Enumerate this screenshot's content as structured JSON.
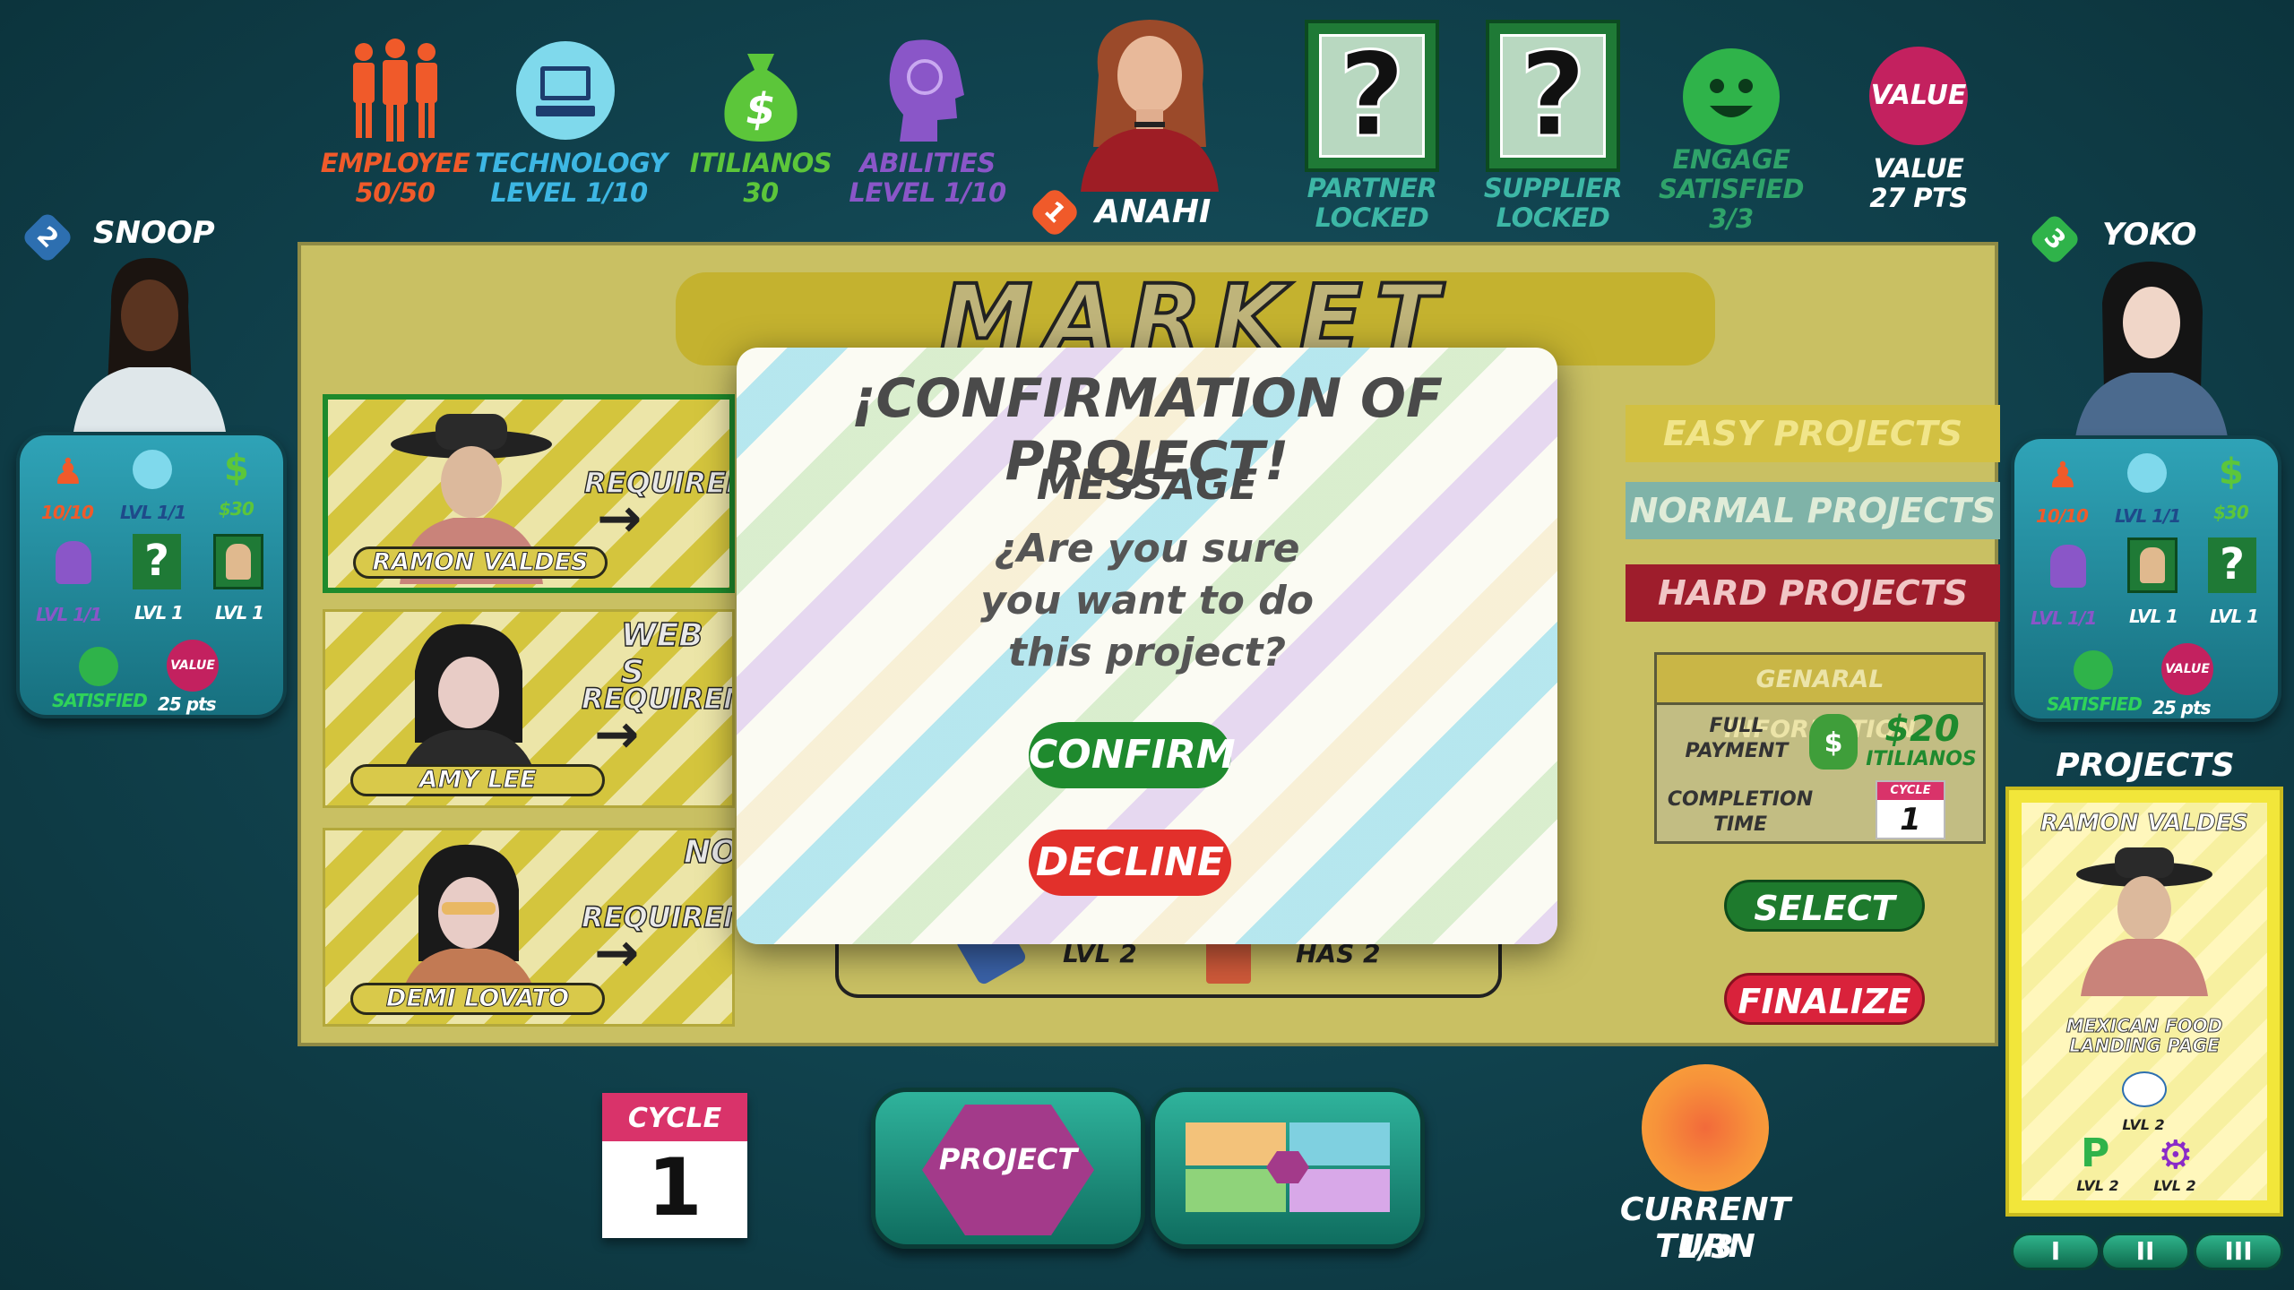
{
  "top_stats": {
    "employee": {
      "label": "EMPLOYEE",
      "value": "50/50"
    },
    "technology": {
      "label": "TECHNOLOGY",
      "value": "LEVEL  1/10"
    },
    "itilianos": {
      "label": "ITILIANOS",
      "value": "30"
    },
    "abilities": {
      "label": "ABILITIES",
      "value": "LEVEL  1/10"
    },
    "partner": {
      "label": "PARTNER",
      "value": "LOCKED"
    },
    "supplier": {
      "label": "SUPPLIER",
      "value": "LOCKED"
    },
    "engage": {
      "label1": "ENGAGE",
      "label2": "SATISFIED",
      "value": "3/3"
    },
    "value": {
      "badge": "VALUE",
      "label": "VALUE",
      "value": "27 PTS"
    }
  },
  "current_player": {
    "number": "1",
    "name": "ANAHI"
  },
  "player_left": {
    "number": "2",
    "name": "SNOOP",
    "stats": {
      "employees": "10/10",
      "tech": "LVL 1/1",
      "money": "$30",
      "abilities": "LVL 1/1",
      "partner": "LVL 1",
      "supplier": "LVL 1",
      "satisfied": "SATISFIED",
      "value_badge": "VALUE",
      "points": "25 pts"
    }
  },
  "player_right": {
    "number": "3",
    "name": "YOKO",
    "stats": {
      "employees": "10/10",
      "tech": "LVL 1/1",
      "money": "$30",
      "abilities": "LVL 1/1",
      "partner": "LVL 1",
      "supplier": "LVL 1",
      "satisfied": "SATISFIED",
      "value_badge": "VALUE",
      "points": "25 pts"
    }
  },
  "board": {
    "title": "MARKET DEMAND",
    "clients": [
      {
        "name": "RAMON VALDES",
        "header": "",
        "req": "REQUIREM"
      },
      {
        "name": "AMY LEE",
        "header": "WEB S",
        "req": "REQUIREM"
      },
      {
        "name": "DEMI LOVATO",
        "header": "NON",
        "req": "REQUIREM"
      }
    ],
    "requirement_row": {
      "level": "LVL 2",
      "has": "HAS 2"
    },
    "tabs": {
      "easy": "EASY PROJECTS",
      "normal": "NORMAL PROJECTS",
      "hard": "HARD PROJECTS"
    },
    "info": {
      "title": "GENARAL INFORMATION",
      "payment_label": "FULL PAYMENT",
      "payment_value": "$20",
      "payment_unit": "ITILIANOS",
      "time_label": "COMPLETION TIME",
      "cycle_badge": "CYCLE",
      "time_value": "1"
    },
    "select_label": "SELECT",
    "finalize_label": "FINALIZE"
  },
  "modal": {
    "title": "¡CONFIRMATION OF PROJECT!",
    "heading": "MESSAGE",
    "line1": "¿Are you sure",
    "line2": "you want to do",
    "line3": "this project?",
    "confirm_label": "CONFIRM",
    "decline_label": "DECLINE"
  },
  "bottom": {
    "cycle_label": "CYCLE",
    "cycle_value": "1",
    "project_button_label": "PROJECT",
    "turn_label": "CURRENT TURN",
    "turn_value": "1/3"
  },
  "projects_panel": {
    "title": "PROJECTS",
    "card": {
      "client": "RAMON VALDES",
      "project_line1": "MEXICAN FOOD",
      "project_line2": "LANDING PAGE",
      "tech_level": "LVL 2",
      "partner_level": "LVL 2",
      "ability_level": "LVL 2"
    },
    "pages": [
      "I",
      "II",
      "III"
    ]
  },
  "colors": {
    "employee": "#f05a2a",
    "technology": "#3db7e4",
    "itilianos": "#5cc63a",
    "abilities": "#8a56c8",
    "partner": "#1f8a3a",
    "engage": "#2fb34a",
    "value_badge": "#c3215f",
    "confirm": "#1f8a2e",
    "decline": "#e2302b",
    "select": "#1e7a2d",
    "finalize": "#d9223b"
  }
}
